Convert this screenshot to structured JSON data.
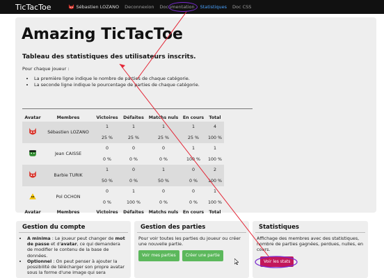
{
  "navbar": {
    "brand": "TicTacToe",
    "user": "Sébastien LOZANO",
    "links": [
      "Deconnexion",
      "Documentation",
      "Statistiques",
      "Doc CSS"
    ],
    "active_index": 2,
    "active_color": "#4aa3ff"
  },
  "main": {
    "title": "Amazing TicTacToe",
    "subtitle": "Tableau des statistiques des utilisateurs inscrits.",
    "intro": "Pour chaque joueur :",
    "bullets": [
      "La première ligne indique le nombre de parties de chaque catégorie.",
      "La seconde ligne indique le pourcentage de parties de chaque catégorie."
    ],
    "table": {
      "headers": [
        "Avatar",
        "Membres",
        "Victoires",
        "Défaites",
        "Matchs nuls",
        "En cours",
        "Total"
      ],
      "rows": [
        {
          "avatar": "devil-icon",
          "member": "Sébastien LOZANO",
          "counts": [
            "1",
            "1",
            "1",
            "1",
            "4"
          ],
          "percents": [
            "25 %",
            "25 %",
            "25 %",
            "25 %",
            "100 %"
          ]
        },
        {
          "avatar": "hulk-icon",
          "member": "Jean CAISSE",
          "counts": [
            "0",
            "0",
            "0",
            "1",
            "1"
          ],
          "percents": [
            "0 %",
            "0 %",
            "0 %",
            "100 %",
            "100 %"
          ]
        },
        {
          "avatar": "devil-icon",
          "member": "Barbie TURIK",
          "counts": [
            "1",
            "0",
            "1",
            "0",
            "2"
          ],
          "percents": [
            "50 %",
            "0 %",
            "50 %",
            "0 %",
            "100 %"
          ]
        },
        {
          "avatar": "bird-icon",
          "member": "Pol OCHON",
          "counts": [
            "0",
            "1",
            "0",
            "0",
            "1"
          ],
          "percents": [
            "0 %",
            "100 %",
            "0 %",
            "0 %",
            "100 %"
          ]
        }
      ]
    }
  },
  "panels": {
    "account": {
      "title": "Gestion du compte",
      "items": [
        {
          "prefix": "A minima",
          "text1": " : Le joueur peut changer de ",
          "bold1": "mot de passe",
          "text2": " et d'",
          "bold2": "avatar",
          "text3": ", ce qui demandera de modifier le contenu de la base de données."
        },
        {
          "prefix": "Optionnel",
          "text1": " : On peut penser à ajouter la possibilité de télécharger son propre avatar sous la forme d'une image qui sera"
        }
      ]
    },
    "games": {
      "title": "Gestion des parties",
      "text": "Pour voir toutes les parties du joueur ou créer une nouvelle partie.",
      "buttons": [
        "Voir mes parties",
        "Créer une partie"
      ]
    },
    "stats": {
      "title": "Statistiques",
      "text": "Affichage des membres avec des statistiques, nombre de parties gagnées, perdues, nulles, en cours.",
      "button": "Voir les stats"
    }
  },
  "colors": {
    "navbar_bg": "#111111",
    "panel_bg": "#eeeeee",
    "button_green": "#5cb85c",
    "button_purple": "#c2185b",
    "annotation_red": "#e32636",
    "annotation_purple": "#7a2bd0"
  }
}
